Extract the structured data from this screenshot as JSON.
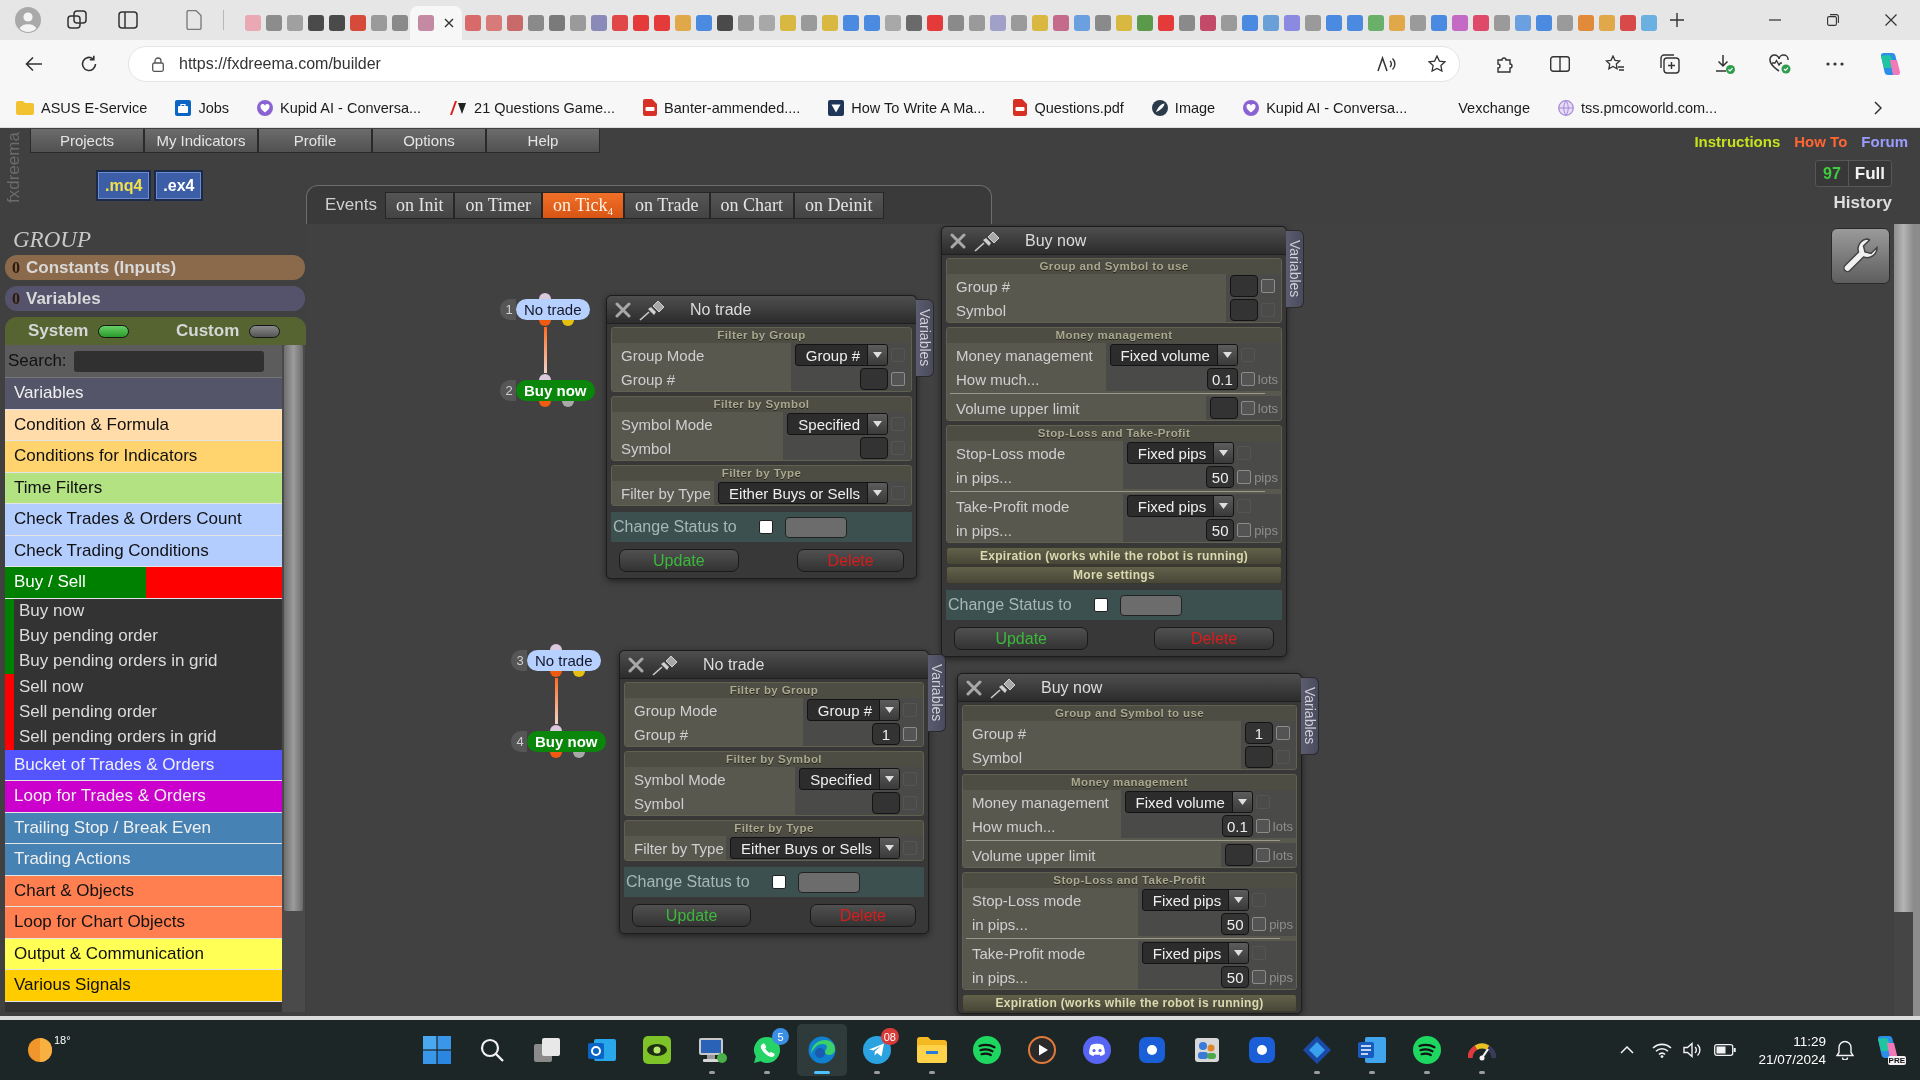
{
  "browser": {
    "tabs": [
      {
        "color": "#e9a8b4",
        "selected": false
      },
      {
        "color": "#8c8c8c",
        "selected": false
      },
      {
        "color": "#a0a0a0",
        "selected": false
      },
      {
        "color": "#4a4a4a",
        "selected": false
      },
      {
        "color": "#4a4a4a",
        "selected": false
      },
      {
        "color": "#d64a3a",
        "selected": false
      },
      {
        "color": "#9a9a9a",
        "selected": false
      },
      {
        "color": "#8a8a8a",
        "selected": false
      },
      {
        "color": "#c48aa4",
        "selected": true
      },
      {
        "color": "#d86a6a",
        "selected": false
      },
      {
        "color": "#d87a7a",
        "selected": false
      },
      {
        "color": "#c86a6a",
        "selected": false
      },
      {
        "color": "#8a8a8a",
        "selected": false
      },
      {
        "color": "#7a7a7a",
        "selected": false
      },
      {
        "color": "#9a9a9a",
        "selected": false
      },
      {
        "color": "#8a8ab8",
        "selected": false
      },
      {
        "color": "#e04848",
        "selected": false
      },
      {
        "color": "#e43a3a",
        "selected": false
      },
      {
        "color": "#e43a3a",
        "selected": false
      },
      {
        "color": "#e0a848",
        "selected": false
      },
      {
        "color": "#4a8ae0",
        "selected": false
      },
      {
        "color": "#4a4a4a",
        "selected": false
      },
      {
        "color": "#9a9a9a",
        "selected": false
      },
      {
        "color": "#a8a8a8",
        "selected": false
      },
      {
        "color": "#d8b840",
        "selected": false
      },
      {
        "color": "#9a9a9a",
        "selected": false
      },
      {
        "color": "#d8b840",
        "selected": false
      },
      {
        "color": "#4a8ae0",
        "selected": false
      },
      {
        "color": "#4a8ae0",
        "selected": false
      },
      {
        "color": "#a8a8a8",
        "selected": false
      },
      {
        "color": "#6a6a6a",
        "selected": false
      },
      {
        "color": "#e43a3a",
        "selected": false
      },
      {
        "color": "#8a8a8a",
        "selected": false
      },
      {
        "color": "#9a9a9a",
        "selected": false
      },
      {
        "color": "#a0a0c8",
        "selected": false
      },
      {
        "color": "#9a9a9a",
        "selected": false
      },
      {
        "color": "#d8b840",
        "selected": false
      },
      {
        "color": "#c46a8a",
        "selected": false
      },
      {
        "color": "#6aa0e0",
        "selected": false
      },
      {
        "color": "#8a8a8a",
        "selected": false
      },
      {
        "color": "#d8b840",
        "selected": false
      },
      {
        "color": "#5a9a4a",
        "selected": false
      },
      {
        "color": "#e43a3a",
        "selected": false
      },
      {
        "color": "#8a8a8a",
        "selected": false
      },
      {
        "color": "#c44a6a",
        "selected": false
      },
      {
        "color": "#9a9a9a",
        "selected": false
      },
      {
        "color": "#4a8ae0",
        "selected": false
      },
      {
        "color": "#6aa0d8",
        "selected": false
      },
      {
        "color": "#8a8ae0",
        "selected": false
      },
      {
        "color": "#9a9a9a",
        "selected": false
      },
      {
        "color": "#4a8ae0",
        "selected": false
      },
      {
        "color": "#4a8ae0",
        "selected": false
      },
      {
        "color": "#6ab06a",
        "selected": false
      },
      {
        "color": "#e0a848",
        "selected": false
      },
      {
        "color": "#9a9a9a",
        "selected": false
      },
      {
        "color": "#4a8ae0",
        "selected": false
      },
      {
        "color": "#c46ac4",
        "selected": false
      },
      {
        "color": "#e04a6a",
        "selected": false
      },
      {
        "color": "#9a9a9a",
        "selected": false
      },
      {
        "color": "#6aa0e0",
        "selected": false
      },
      {
        "color": "#4a8ae0",
        "selected": false
      },
      {
        "color": "#9a9a9a",
        "selected": false
      },
      {
        "color": "#e08a3a",
        "selected": false
      },
      {
        "color": "#e0a848",
        "selected": false
      },
      {
        "color": "#d84a4a",
        "selected": false
      },
      {
        "color": "#6ab0e0",
        "selected": false
      }
    ],
    "address": {
      "url": "https://fxdreema.com/builder"
    },
    "bookmarks": [
      {
        "kind": "folder",
        "label": "ASUS E-Service"
      },
      {
        "kind": "tile",
        "label": "Jobs"
      },
      {
        "kind": "circle",
        "label": "Kupid AI - Conversa..."
      },
      {
        "kind": "mark",
        "label": "21 Questions Game..."
      },
      {
        "kind": "pdf",
        "label": "Banter-ammended...."
      },
      {
        "kind": "square",
        "label": "How To Write A Ma..."
      },
      {
        "kind": "pdf",
        "label": "Questions.pdf"
      },
      {
        "kind": "feather",
        "label": "Image"
      },
      {
        "kind": "circle",
        "label": "Kupid AI - Conversa..."
      },
      {
        "kind": "blank",
        "label": "Vexchange"
      },
      {
        "kind": "globe",
        "label": "tss.pmcoworld.com..."
      }
    ]
  },
  "app": {
    "logo": "fxdreema",
    "menu": [
      "Projects",
      "My Indicators",
      "Profile",
      "Options",
      "Help"
    ],
    "exports": [
      {
        "label": ".mq4",
        "selected": true
      },
      {
        "label": ".ex4",
        "selected": false
      }
    ],
    "events": {
      "label": "Events",
      "tabs": [
        {
          "label": "on Init",
          "selected": false
        },
        {
          "label": "on Timer",
          "selected": false
        },
        {
          "label": "on Tick$_{4}$",
          "selected": true
        },
        {
          "label": "on Trade",
          "selected": false
        },
        {
          "label": "on Chart",
          "selected": false
        },
        {
          "label": "on Deinit",
          "selected": false
        }
      ]
    },
    "links": [
      {
        "label": "Instructions",
        "color": "#c6e21e"
      },
      {
        "label": "How To",
        "color": "#ff6633"
      },
      {
        "label": "Forum",
        "color": "#9c9cff"
      }
    ],
    "counter": "97",
    "view": "Full",
    "history": "History"
  },
  "sidebar": {
    "title": "GROUP",
    "groups": [
      {
        "count": "0",
        "label": "Constants (Inputs)",
        "color": "#8b6a4c"
      },
      {
        "count": "0",
        "label": "Variables",
        "color": "#55536b"
      }
    ],
    "toggles": [
      {
        "label": "System",
        "on": true
      },
      {
        "label": "Custom",
        "on": false
      }
    ],
    "search": {
      "label": "Search:"
    },
    "categories": [
      {
        "label": "Variables",
        "color": "#55556a"
      },
      {
        "label": "Condition & Formula",
        "color": "#ffdcaa"
      },
      {
        "label": "Conditions for Indicators",
        "color": "#ffd46e"
      },
      {
        "label": "Time Filters",
        "color": "#b2e282"
      },
      {
        "label": "Check Trades & Orders Count",
        "color": "#b4cdff"
      },
      {
        "label": "Check Trading Conditions",
        "color": "#b4cdff"
      },
      {
        "label": "Buy / Sell",
        "groups": [
          {
            "color": "#008000",
            "items": [
              "Buy now",
              "Buy pending order",
              "Buy pending orders in grid"
            ]
          },
          {
            "color": "#ff0000",
            "items": [
              "Sell now",
              "Sell pending order",
              "Sell pending orders in grid"
            ]
          }
        ]
      },
      {
        "label": "Bucket of Trades & Orders",
        "color": "#5555ff"
      },
      {
        "label": "Loop for Trades & Orders",
        "color": "#cc00cc"
      },
      {
        "label": "Trailing Stop / Break Even",
        "color": "#4682b4"
      },
      {
        "label": "Trading Actions",
        "color": "#4682b4"
      },
      {
        "label": "Chart & Objects",
        "color": "#ff7f50"
      },
      {
        "label": "Loop for Chart Objects",
        "color": "#ff7f50"
      },
      {
        "label": "Output & Communication",
        "color": "#ffff55"
      },
      {
        "label": "Various Signals",
        "color": "#ffcc00"
      }
    ]
  },
  "canvas": {
    "flows": [
      {
        "nodes": [
          {
            "number": "1",
            "label": "No trade",
            "kind": "condition"
          },
          {
            "number": "2",
            "label": "Buy now",
            "kind": "action"
          }
        ]
      },
      {
        "nodes": [
          {
            "number": "3",
            "label": "No trade",
            "kind": "condition"
          },
          {
            "number": "4",
            "label": "Buy now",
            "kind": "action"
          }
        ]
      }
    ],
    "panels": [
      {
        "title": "No trade",
        "side_tab": "Variables",
        "sections": [
          {
            "kind": "open",
            "heading": "Filter by Group",
            "groups": [
              {
                "rows": [
                  {
                    "label": "Group Mode",
                    "kind": "select",
                    "value": "Group #",
                    "checkbox_disabled": true
                  },
                  {
                    "label": "Group #",
                    "kind": "input",
                    "checkbox_disabled": false
                  }
                ]
              }
            ]
          },
          {
            "kind": "open",
            "heading": "Filter by Symbol",
            "groups": [
              {
                "rows": [
                  {
                    "label": "Symbol Mode",
                    "kind": "select",
                    "value": "Specified",
                    "checkbox_disabled": true
                  },
                  {
                    "label": "Symbol",
                    "kind": "input",
                    "checkbox_disabled": true
                  }
                ]
              }
            ]
          },
          {
            "kind": "open",
            "heading": "Filter by Type",
            "groups": [
              {
                "rows": [
                  {
                    "label": "Filter by Type",
                    "kind": "select",
                    "value": "Either Buys or Sells",
                    "checkbox_disabled": true
                  }
                ]
              }
            ]
          }
        ],
        "status": {
          "label": "Change Status to",
          "checked": false
        },
        "buttons": [
          {
            "kind": "update",
            "label": "Update"
          },
          {
            "kind": "delete",
            "label": "Delete"
          }
        ]
      },
      {
        "title": "Buy now",
        "side_tab": "Variables",
        "sections": [
          {
            "kind": "open",
            "heading": "Group and Symbol to use",
            "groups": [
              {
                "rows": [
                  {
                    "label": "Group #",
                    "kind": "input",
                    "checkbox_disabled": false
                  },
                  {
                    "label": "Symbol",
                    "kind": "input",
                    "checkbox_disabled": true
                  }
                ]
              }
            ]
          },
          {
            "kind": "open",
            "heading": "Money management",
            "groups": [
              {
                "rows": [
                  {
                    "label": "Money management",
                    "kind": "select",
                    "value": "Fixed volume",
                    "checkbox_disabled": true
                  },
                  {
                    "label": "How much...",
                    "kind": "input",
                    "value": "0.1",
                    "unit": "lots",
                    "checkbox_disabled": false
                  }
                ]
              },
              {
                "rows": [
                  {
                    "label": "Volume upper limit",
                    "kind": "input",
                    "unit": "lots",
                    "checkbox_disabled": false
                  }
                ]
              }
            ]
          },
          {
            "kind": "open",
            "heading": "Stop-Loss and Take-Profit",
            "groups": [
              {
                "rows": [
                  {
                    "label": "Stop-Loss mode",
                    "kind": "select",
                    "value": "Fixed pips",
                    "checkbox_disabled": true
                  },
                  {
                    "label": "in pips...",
                    "kind": "input",
                    "value": "50",
                    "unit": "pips",
                    "checkbox_disabled": false
                  }
                ]
              },
              {
                "rows": [
                  {
                    "label": "Take-Profit mode",
                    "kind": "select",
                    "value": "Fixed pips",
                    "checkbox_disabled": true
                  },
                  {
                    "label": "in pips...",
                    "kind": "input",
                    "value": "50",
                    "unit": "pips",
                    "checkbox_disabled": false
                  }
                ]
              }
            ]
          },
          {
            "kind": "collapsed",
            "heading": "Expiration (works while the robot is running)"
          },
          {
            "kind": "collapsed",
            "heading": "More settings"
          }
        ],
        "status": {
          "label": "Change Status to",
          "checked": false
        },
        "buttons": [
          {
            "kind": "update",
            "label": "Update"
          },
          {
            "kind": "delete",
            "label": "Delete"
          }
        ]
      },
      {
        "title": "No trade",
        "side_tab": "Variables",
        "sections": [
          {
            "kind": "open",
            "heading": "Filter by Group",
            "groups": [
              {
                "rows": [
                  {
                    "label": "Group Mode",
                    "kind": "select",
                    "value": "Group #",
                    "checkbox_disabled": true
                  },
                  {
                    "label": "Group #",
                    "kind": "input",
                    "value": "1",
                    "checkbox_disabled": false
                  }
                ]
              }
            ]
          },
          {
            "kind": "open",
            "heading": "Filter by Symbol",
            "groups": [
              {
                "rows": [
                  {
                    "label": "Symbol Mode",
                    "kind": "select",
                    "value": "Specified",
                    "checkbox_disabled": true
                  },
                  {
                    "label": "Symbol",
                    "kind": "input",
                    "checkbox_disabled": true
                  }
                ]
              }
            ]
          },
          {
            "kind": "open",
            "heading": "Filter by Type",
            "groups": [
              {
                "rows": [
                  {
                    "label": "Filter by Type",
                    "kind": "select",
                    "value": "Either Buys or Sells",
                    "checkbox_disabled": true
                  }
                ]
              }
            ]
          }
        ],
        "status": {
          "label": "Change Status to",
          "checked": false
        },
        "buttons": [
          {
            "kind": "update",
            "label": "Update"
          },
          {
            "kind": "delete",
            "label": "Delete"
          }
        ]
      },
      {
        "title": "Buy now",
        "side_tab": "Variables",
        "sections": [
          {
            "kind": "open",
            "heading": "Group and Symbol to use",
            "groups": [
              {
                "rows": [
                  {
                    "label": "Group #",
                    "kind": "input",
                    "value": "1",
                    "checkbox_disabled": false
                  },
                  {
                    "label": "Symbol",
                    "kind": "input",
                    "checkbox_disabled": true
                  }
                ]
              }
            ]
          },
          {
            "kind": "open",
            "heading": "Money management",
            "groups": [
              {
                "rows": [
                  {
                    "label": "Money management",
                    "kind": "select",
                    "value": "Fixed volume",
                    "checkbox_disabled": true
                  },
                  {
                    "label": "How much...",
                    "kind": "input",
                    "value": "0.1",
                    "unit": "lots",
                    "checkbox_disabled": false
                  }
                ]
              },
              {
                "rows": [
                  {
                    "label": "Volume upper limit",
                    "kind": "input",
                    "unit": "lots",
                    "checkbox_disabled": false
                  }
                ]
              }
            ]
          },
          {
            "kind": "open",
            "heading": "Stop-Loss and Take-Profit",
            "groups": [
              {
                "rows": [
                  {
                    "label": "Stop-Loss mode",
                    "kind": "select",
                    "value": "Fixed pips",
                    "checkbox_disabled": true
                  },
                  {
                    "label": "in pips...",
                    "kind": "input",
                    "value": "50",
                    "unit": "pips",
                    "checkbox_disabled": false
                  }
                ]
              },
              {
                "rows": [
                  {
                    "label": "Take-Profit mode",
                    "kind": "select",
                    "value": "Fixed pips",
                    "checkbox_disabled": true
                  },
                  {
                    "label": "in pips...",
                    "kind": "input",
                    "value": "50",
                    "unit": "pips",
                    "checkbox_disabled": false
                  }
                ]
              }
            ]
          },
          {
            "kind": "collapsed",
            "heading": "Expiration (works while the robot is running)"
          }
        ]
      }
    ]
  },
  "taskbar": {
    "weather": "18°",
    "apps": [
      {
        "kind": "windows",
        "running": false,
        "selected": false
      },
      {
        "kind": "search",
        "running": false,
        "selected": false
      },
      {
        "kind": "taskview",
        "running": false,
        "selected": false
      },
      {
        "kind": "mail",
        "running": false,
        "selected": false
      },
      {
        "kind": "eye",
        "running": false,
        "selected": false
      },
      {
        "kind": "computer",
        "running": true,
        "selected": false
      },
      {
        "kind": "chat",
        "running": true,
        "selected": false,
        "badge": "5"
      },
      {
        "kind": "browser",
        "running": true,
        "selected": true
      },
      {
        "kind": "plane",
        "running": true,
        "selected": false,
        "badge": "08"
      },
      {
        "kind": "folder",
        "running": true,
        "selected": false
      },
      {
        "kind": "music",
        "running": false,
        "selected": false
      },
      {
        "kind": "play",
        "running": false,
        "selected": false
      },
      {
        "kind": "controller",
        "running": false,
        "selected": false
      },
      {
        "kind": "ptile",
        "running": false,
        "selected": false
      },
      {
        "kind": "people",
        "running": false,
        "selected": false
      },
      {
        "kind": "ptile",
        "running": false,
        "selected": false
      },
      {
        "kind": "diamond",
        "running": true,
        "selected": false
      },
      {
        "kind": "document",
        "running": true,
        "selected": false
      },
      {
        "kind": "music",
        "running": true,
        "selected": false
      },
      {
        "kind": "gauge",
        "running": true,
        "selected": false
      }
    ],
    "time": "11:29",
    "date": "21/07/2024",
    "copilot_badge": "PRE"
  }
}
